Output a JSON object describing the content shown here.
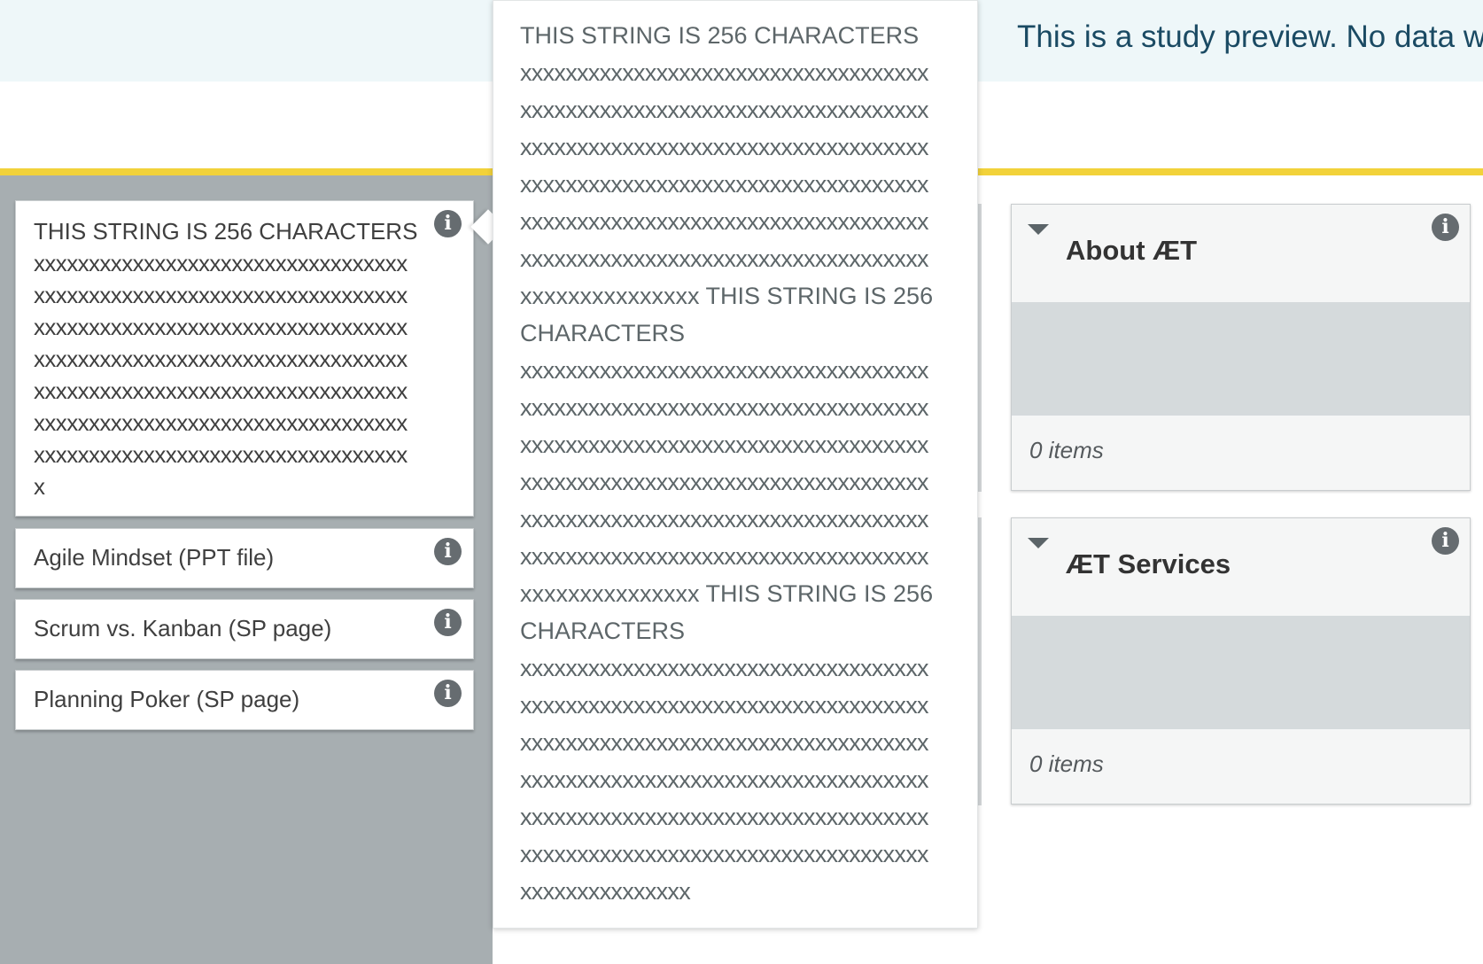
{
  "banner": {
    "text": "This is a study preview. No data w"
  },
  "cards": [
    {
      "title": "THIS STRING IS 256 CHARACTERS",
      "lines": [
        "xxxxxxxxxxxxxxxxxxxxxxxxxxxxxxxxxx",
        "xxxxxxxxxxxxxxxxxxxxxxxxxxxxxxxxxx",
        "xxxxxxxxxxxxxxxxxxxxxxxxxxxxxxxxxx",
        "xxxxxxxxxxxxxxxxxxxxxxxxxxxxxxxxxx",
        "xxxxxxxxxxxxxxxxxxxxxxxxxxxxxxxxxx",
        "xxxxxxxxxxxxxxxxxxxxxxxxxxxxxxxxxx",
        "xxxxxxxxxxxxxxxxxxxxxxxxxxxxxxxxxx",
        "x"
      ]
    },
    {
      "title": "Agile Mindset (PPT file)"
    },
    {
      "title": "Scrum vs. Kanban (SP page)"
    },
    {
      "title": "Planning Poker (SP page)"
    }
  ],
  "info_icon_glyph": "i",
  "tooltip": {
    "lines": [
      "THIS STRING IS 256 CHARACTERS",
      "xxxxxxxxxxxxxxxxxxxxxxxxxxxxxxxxxxxx",
      "xxxxxxxxxxxxxxxxxxxxxxxxxxxxxxxxxxxx",
      "xxxxxxxxxxxxxxxxxxxxxxxxxxxxxxxxxxxx",
      "xxxxxxxxxxxxxxxxxxxxxxxxxxxxxxxxxxxx",
      "xxxxxxxxxxxxxxxxxxxxxxxxxxxxxxxxxxxx",
      "xxxxxxxxxxxxxxxxxxxxxxxxxxxxxxxxxxxx",
      "xxxxxxxxxxxxxxx THIS STRING IS 256",
      "CHARACTERS",
      "xxxxxxxxxxxxxxxxxxxxxxxxxxxxxxxxxxxx",
      "xxxxxxxxxxxxxxxxxxxxxxxxxxxxxxxxxxxx",
      "xxxxxxxxxxxxxxxxxxxxxxxxxxxxxxxxxxxx",
      "xxxxxxxxxxxxxxxxxxxxxxxxxxxxxxxxxxxx",
      "xxxxxxxxxxxxxxxxxxxxxxxxxxxxxxxxxxxx",
      "xxxxxxxxxxxxxxxxxxxxxxxxxxxxxxxxxxxx",
      "xxxxxxxxxxxxxxx THIS STRING IS 256",
      "CHARACTERS",
      "xxxxxxxxxxxxxxxxxxxxxxxxxxxxxxxxxxxx",
      "xxxxxxxxxxxxxxxxxxxxxxxxxxxxxxxxxxxx",
      "xxxxxxxxxxxxxxxxxxxxxxxxxxxxxxxxxxxx",
      "xxxxxxxxxxxxxxxxxxxxxxxxxxxxxxxxxxxx",
      "xxxxxxxxxxxxxxxxxxxxxxxxxxxxxxxxxxxx",
      "xxxxxxxxxxxxxxxxxxxxxxxxxxxxxxxxxxxx",
      "xxxxxxxxxxxxxxx"
    ]
  },
  "categories": [
    {
      "title": "About ÆT",
      "count": "0 items"
    },
    {
      "title": "ÆT Services",
      "count": "0 items"
    }
  ],
  "colors": {
    "accent_line": "#f2d23a",
    "banner_bg": "#eef7f9",
    "banner_text": "#1a4a63",
    "panel_bg": "#a7aeb1"
  }
}
